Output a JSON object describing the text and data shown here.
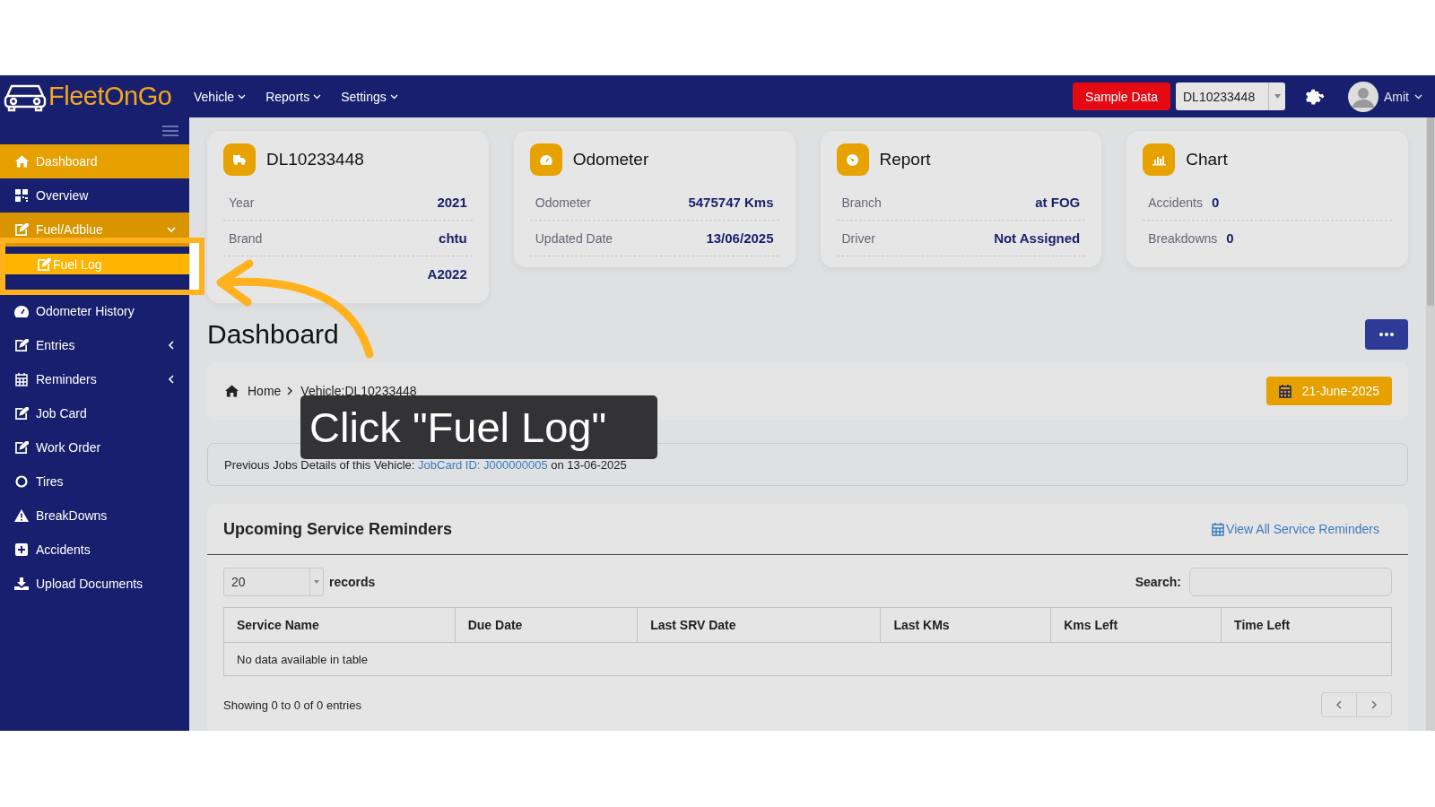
{
  "header": {
    "logo": "FleetOnGo",
    "menus": [
      {
        "label": "Vehicle"
      },
      {
        "label": "Reports"
      },
      {
        "label": "Settings"
      }
    ],
    "sample_data_button": "Sample Data",
    "vehicle_select": "DL10233448",
    "user": "Amit"
  },
  "sidebar": {
    "items": [
      {
        "label": "Dashboard",
        "selected": true
      },
      {
        "label": "Overview",
        "selected": false
      },
      {
        "label": "Fuel/Adblue",
        "selected": false,
        "expanded": true,
        "children": [
          {
            "label": "Fuel Log",
            "selected": true
          }
        ]
      },
      {
        "label": "Odometer History",
        "selected": false
      },
      {
        "label": "Entries",
        "selected": false,
        "expanded": false
      },
      {
        "label": "Reminders",
        "selected": false,
        "expanded": false
      },
      {
        "label": "Job Card",
        "selected": false
      },
      {
        "label": "Work Order",
        "selected": false
      },
      {
        "label": "Tires",
        "selected": false
      },
      {
        "label": "BreakDowns",
        "selected": false
      },
      {
        "label": "Accidents",
        "selected": false
      },
      {
        "label": "Upload Documents",
        "selected": false
      }
    ]
  },
  "cards": [
    {
      "title": "DL10233448",
      "kind": "pairs",
      "rows": [
        {
          "label": "Year",
          "value": "2021"
        },
        {
          "label": "Brand",
          "value": "chtu"
        },
        {
          "value": "A2022"
        }
      ]
    },
    {
      "title": "Odometer",
      "kind": "pairs",
      "rows": [
        {
          "label": "Odometer",
          "value": "5475747 Kms"
        },
        {
          "label": "Updated Date",
          "value": "13/06/2025"
        }
      ]
    },
    {
      "title": "Report",
      "kind": "pairs",
      "rows": [
        {
          "label": "Branch",
          "value": "at FOG"
        },
        {
          "label": "Driver",
          "value": "Not Assigned"
        }
      ]
    },
    {
      "title": "Chart",
      "kind": "inline",
      "rows": [
        {
          "label": "Accidents",
          "value": "0"
        },
        {
          "label": "Breakdowns",
          "value": "0"
        }
      ]
    }
  ],
  "page_title": "Dashboard",
  "breadcrumb": [
    "Home",
    "Vehicle:DL10233448"
  ],
  "date_badge": "21-June-2025",
  "job_notice": {
    "text": "Previous Jobs Details of this Vehicle:",
    "link": "JobCard ID: J000000005",
    "suffix": "on 13-06-2025"
  },
  "reminders": {
    "title": "Upcoming Service Reminders",
    "view_all_link": "View All Service Reminders",
    "page_size": "20",
    "page_size_label": "records",
    "search_label": "Search:",
    "columns": [
      "Service Name",
      "Due Date",
      "Last SRV Date",
      "Last KMs",
      "Kms Left",
      "Time Left"
    ],
    "empty_message": "No data available in table",
    "info": "Showing 0 to 0 of 0 entries"
  },
  "tooltip": "Click \"Fuel Log\""
}
